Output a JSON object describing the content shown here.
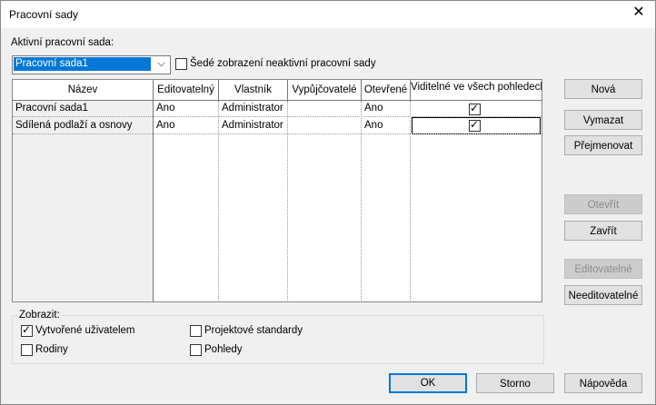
{
  "window": {
    "title": "Pracovní sady"
  },
  "active_workset": {
    "label": "Aktivní pracovní sada:",
    "value": "Pracovní sada1"
  },
  "gray_inactive": {
    "label": "Šedé zobrazení neaktivní pracovní sady",
    "checked": false
  },
  "table": {
    "headers": [
      "Název",
      "Editovatelný",
      "Vlastník",
      "Vypůjčovatelé",
      "Otevřené",
      "Viditelné ve všech pohledech"
    ],
    "rows": [
      {
        "name": "Pracovní sada1",
        "editable": "Ano",
        "owner": "Administrator",
        "borrowers": "",
        "opened": "Ano",
        "visible": true
      },
      {
        "name": "Sdílená podlaží a osnovy",
        "editable": "Ano",
        "owner": "Administrator",
        "borrowers": "",
        "opened": "Ano",
        "visible": true
      }
    ]
  },
  "buttons": {
    "new": "Nová",
    "delete": "Vymazat",
    "rename": "Přejmenovat",
    "open": "Otevřít",
    "close": "Zavřít",
    "editable": "Editovatelné",
    "non_editable": "Needitovatelné",
    "ok": "OK",
    "cancel": "Storno",
    "help": "Nápověda"
  },
  "show": {
    "label": "Zobrazit:",
    "user_created": {
      "label": "Vytvořené uživatelem",
      "checked": true
    },
    "project_standards": {
      "label": "Projektové standardy",
      "checked": false
    },
    "families": {
      "label": "Rodiny",
      "checked": false
    },
    "views": {
      "label": "Pohledy",
      "checked": false
    }
  }
}
